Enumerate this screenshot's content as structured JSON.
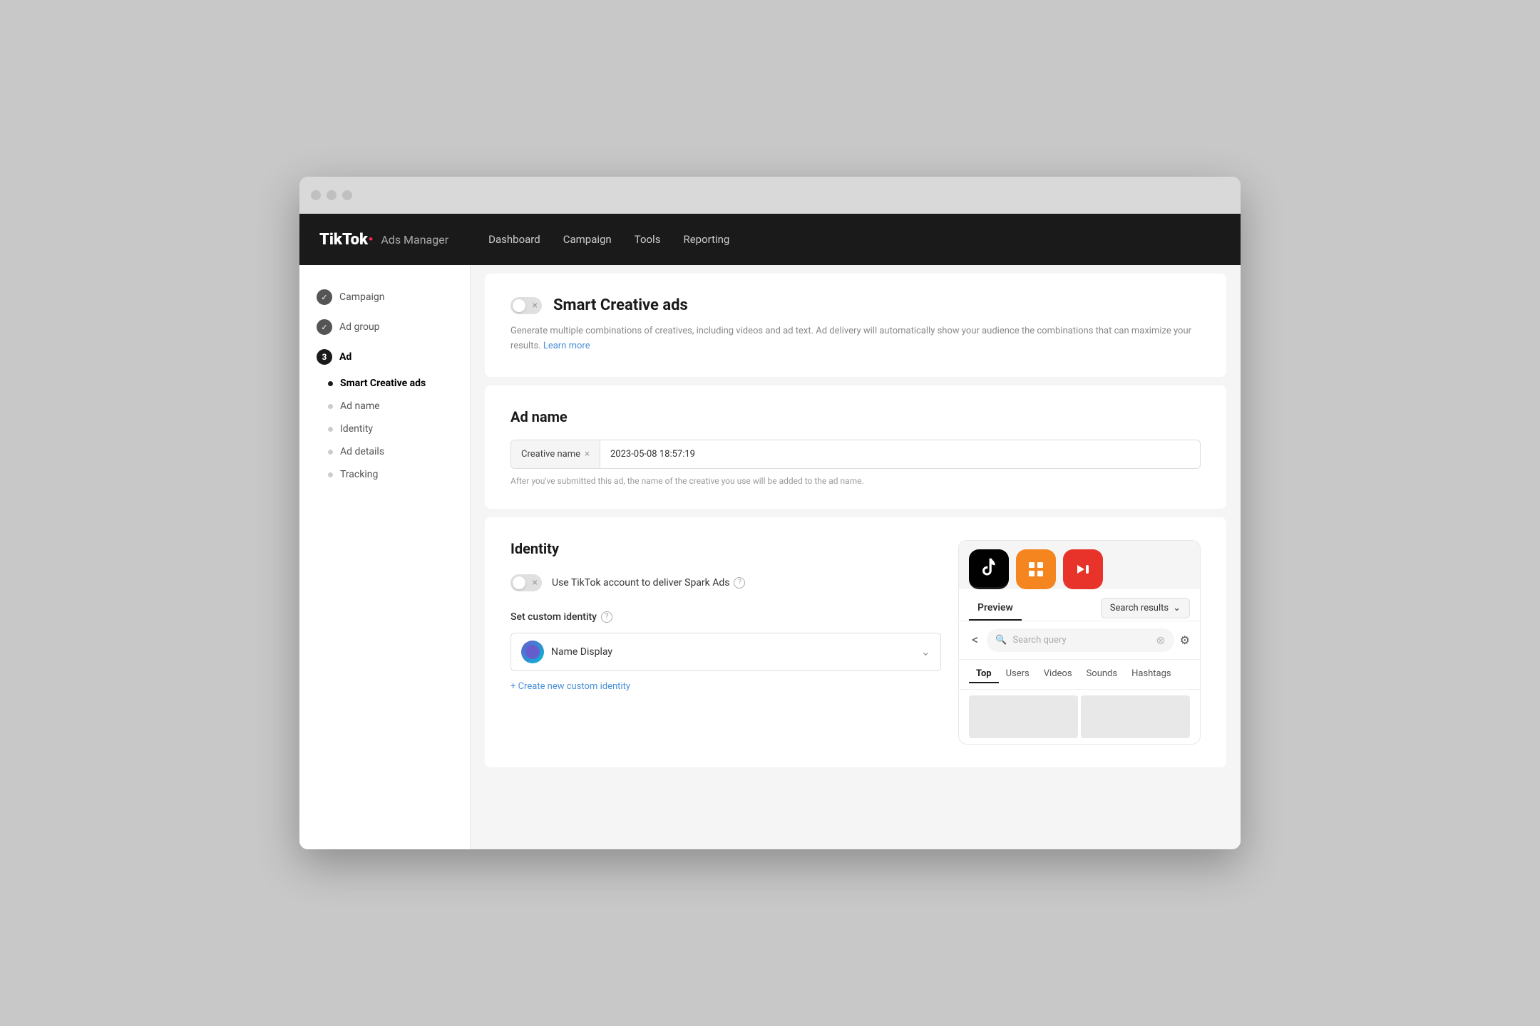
{
  "window": {
    "title": "TikTok Ads Manager"
  },
  "topnav": {
    "brand": "TikTok",
    "brand_dot": "·",
    "brand_suffix": "Ads Manager",
    "items": [
      {
        "label": "Dashboard"
      },
      {
        "label": "Campaign"
      },
      {
        "label": "Tools"
      },
      {
        "label": "Reporting"
      }
    ]
  },
  "sidebar": {
    "items": [
      {
        "label": "Campaign",
        "type": "check-done"
      },
      {
        "label": "Ad group",
        "type": "check-done"
      },
      {
        "label": "Ad",
        "type": "number",
        "number": "3"
      }
    ],
    "sub_items": [
      {
        "label": "Smart Creative ads",
        "type": "dot-active"
      },
      {
        "label": "Ad name",
        "type": "dot"
      },
      {
        "label": "Identity",
        "type": "dot"
      },
      {
        "label": "Ad details",
        "type": "dot"
      },
      {
        "label": "Tracking",
        "type": "dot"
      }
    ]
  },
  "smart_creative": {
    "title": "Smart Creative ads",
    "description": "Generate multiple combinations of creatives, including videos and ad text. Ad delivery will automatically show your audience the combinations that can maximize your results.",
    "learn_more": "Learn more"
  },
  "ad_name": {
    "title": "Ad name",
    "tag": "Creative name",
    "tag_close": "×",
    "value": "2023-05-08 18:57:19",
    "hint": "After you've submitted this ad, the name of the creative you use will be added to the ad name."
  },
  "identity": {
    "title": "Identity",
    "spark_label": "Use TikTok account to deliver Spark Ads",
    "custom_identity_label": "Set custom identity",
    "identity_name": "Name Display",
    "create_custom": "+ Create new custom identity"
  },
  "preview": {
    "tab_preview": "Preview",
    "tab_search_results": "Search results",
    "search_placeholder": "Search query",
    "filter_tabs": [
      "Top",
      "Users",
      "Videos",
      "Sounds",
      "Hashtags"
    ]
  }
}
